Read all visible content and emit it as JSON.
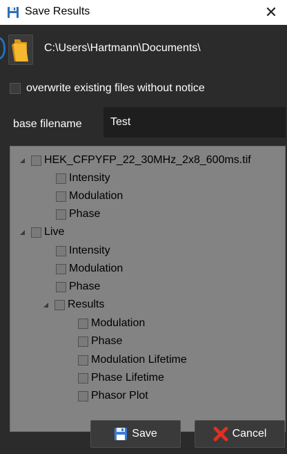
{
  "window": {
    "title": "Save Results",
    "close_glyph": "✕"
  },
  "path": {
    "folder_icon": "folder-icon",
    "text": "C:\\Users\\Hartmann\\Documents\\"
  },
  "options": {
    "overwrite_label": "overwrite existing files without notice",
    "overwrite_checked": false
  },
  "basename": {
    "label": "base filename",
    "value": "Test"
  },
  "tree": {
    "file_node": {
      "label": "HEK_CFPYFP_22_30MHz_2x8_600ms.tif",
      "expanded": true,
      "children": [
        "Intensity",
        "Modulation",
        "Phase"
      ]
    },
    "live_node": {
      "label": "Live",
      "expanded": true,
      "children": [
        "Intensity",
        "Modulation",
        "Phase"
      ],
      "results_node": {
        "label": "Results",
        "expanded": true,
        "children": [
          "Modulation",
          "Phase",
          "Modulation Lifetime",
          "Phase Lifetime",
          "Phasor Plot"
        ]
      }
    }
  },
  "buttons": {
    "save_label": "Save",
    "cancel_label": "Cancel"
  },
  "colors": {
    "window_bg": "#2b2b2b",
    "tree_bg": "#838383",
    "cancel_icon": "#e03020",
    "save_icon": "#3a7bd5"
  }
}
